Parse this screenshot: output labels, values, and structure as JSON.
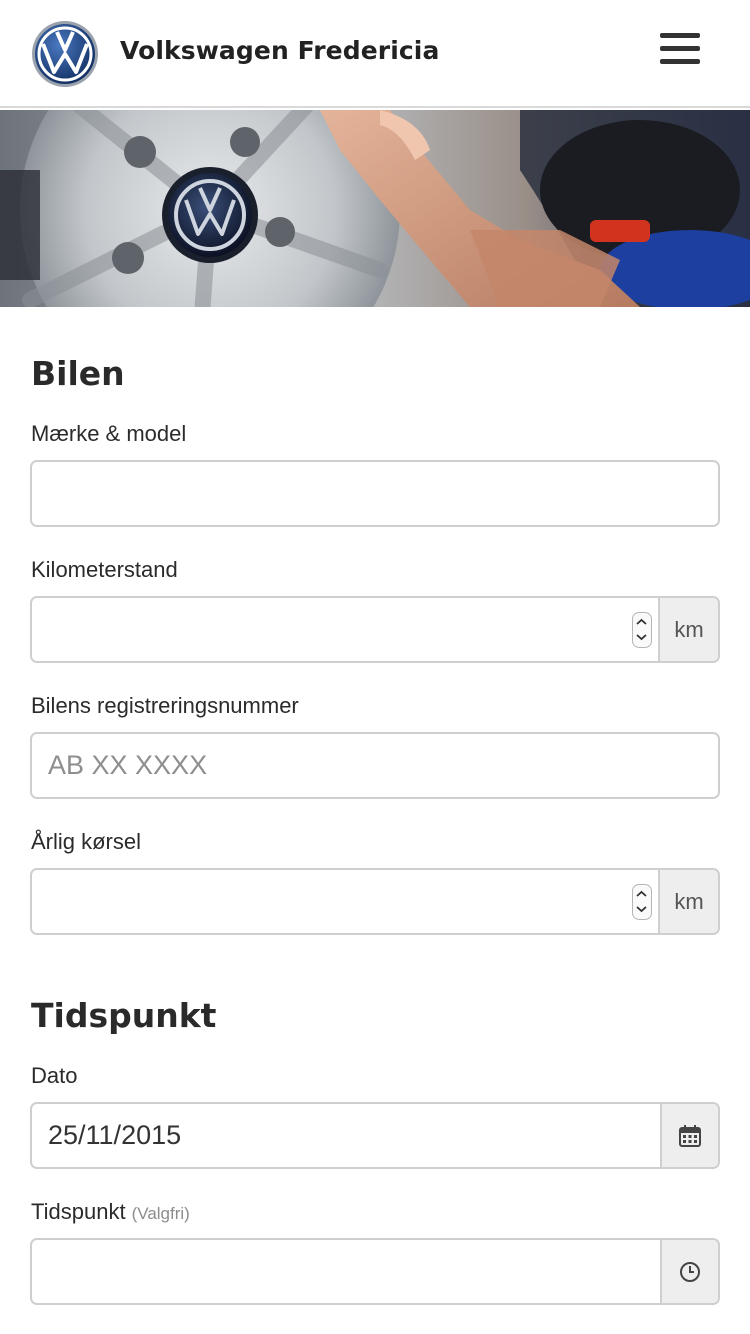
{
  "header": {
    "brand": "Volkswagen Fredericia"
  },
  "sections": {
    "car": {
      "title": "Bilen",
      "make_model": {
        "label": "Mærke & model",
        "value": "",
        "placeholder": ""
      },
      "mileage": {
        "label": "Kilometerstand",
        "value": "",
        "unit": "km"
      },
      "registration": {
        "label": "Bilens registreringsnummer",
        "value": "",
        "placeholder": "AB XX XXXX"
      },
      "annual": {
        "label": "Årlig kørsel",
        "value": "",
        "unit": "km"
      }
    },
    "time": {
      "title": "Tidspunkt",
      "date": {
        "label": "Dato",
        "value": "25/11/2015"
      },
      "time": {
        "label": "Tidspunkt",
        "optional": "(Valgfri)",
        "value": ""
      }
    }
  },
  "icons": [
    "vw-logo-icon",
    "hamburger-menu-icon",
    "calendar-icon",
    "clock-icon"
  ],
  "colors": {
    "vw_blue": "#1d3f7a",
    "border": "#cfcfcf",
    "addon_bg": "#eeeeee"
  }
}
